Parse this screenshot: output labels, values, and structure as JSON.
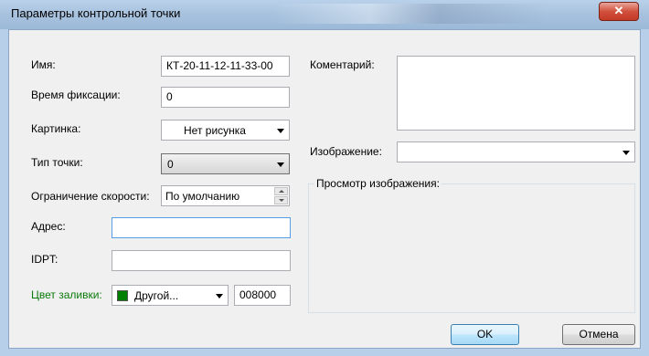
{
  "window": {
    "title": "Параметры контрольной точки",
    "close_symbol": "✕"
  },
  "form": {
    "name": {
      "label": "Имя:",
      "value": "КТ-20-11-12-11-33-00"
    },
    "fix_time": {
      "label": "Время фиксации:",
      "value": "0"
    },
    "picture": {
      "label": "Картинка:",
      "value": "Нет рисунка"
    },
    "point_type": {
      "label": "Тип точки:",
      "value": "0"
    },
    "speed_limit": {
      "label": "Ограничение скорости:",
      "value": "По умолчанию"
    },
    "address": {
      "label": "Адрес:",
      "value": ""
    },
    "idpt": {
      "label": "IDPT:",
      "value": ""
    },
    "fill_color": {
      "label": "Цвет заливки:",
      "selected": "Другой...",
      "hex": "008000",
      "swatch_color": "#008000"
    },
    "comment": {
      "label": "Коментарий:",
      "value": ""
    },
    "image": {
      "label": "Изображение:",
      "value": ""
    },
    "preview": {
      "label": "Просмотр изображения:"
    }
  },
  "buttons": {
    "ok": "OK",
    "cancel": "Отмена"
  }
}
